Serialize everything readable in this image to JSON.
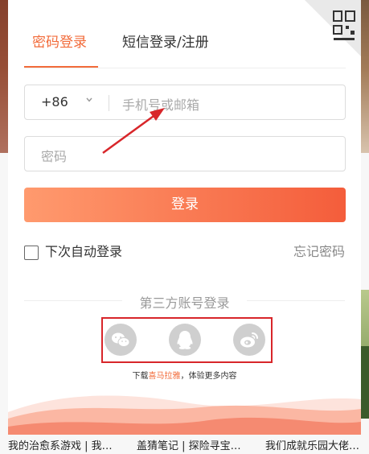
{
  "tabs": [
    {
      "label": "密码登录",
      "active": true
    },
    {
      "label": "短信登录/注册",
      "active": false
    }
  ],
  "phone": {
    "country_code": "+86",
    "placeholder": "手机号或邮箱"
  },
  "password": {
    "placeholder": "密码"
  },
  "login_button": "登录",
  "auto_login_label": "下次自动登录",
  "auto_login_checked": false,
  "forgot_password": "忘记密码",
  "third_party": {
    "title": "第三方账号登录",
    "providers": [
      "wechat-icon",
      "qq-icon",
      "weibo-icon"
    ]
  },
  "download": {
    "prefix": "下载",
    "brand": "喜马拉雅",
    "suffix": "，体验更多内容"
  },
  "background_texts": [
    "我的治愈系游戏 | 我…",
    "盖猜笔记 | 探险寻宝…",
    "我们成就乐园大佬…"
  ],
  "colors": {
    "accent": "#f26b3a",
    "annotation": "#d8262a",
    "social_icon_bg": "#cfcfcf"
  }
}
